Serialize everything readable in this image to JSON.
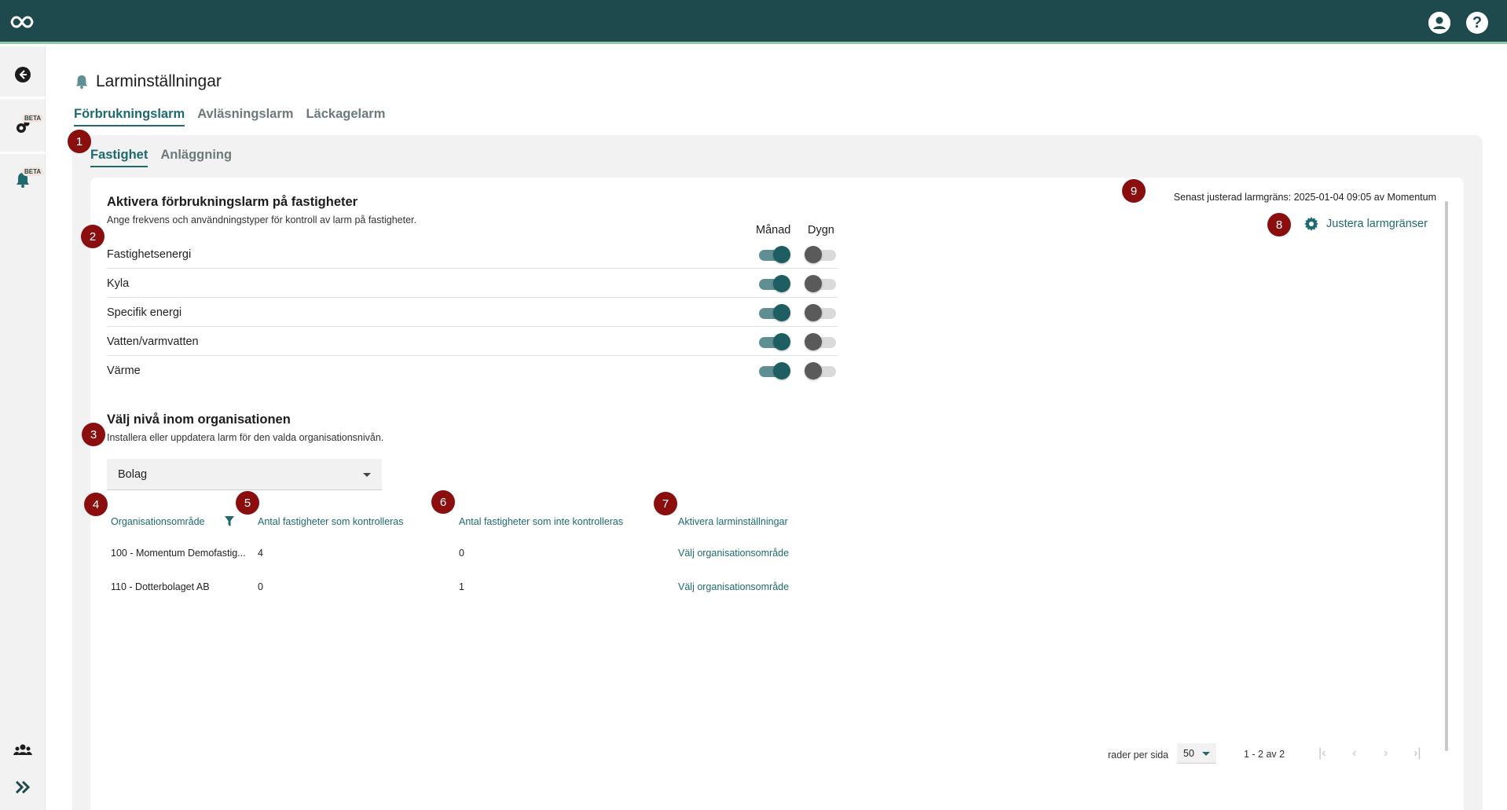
{
  "topbar": {
    "logo_icon": "infinity-logo-icon",
    "account_icon": "account-icon",
    "help_icon": "help-icon"
  },
  "rail": {
    "back_icon": "arrow-left-icon",
    "settings_beta": "BETA",
    "alarm_beta": "BETA",
    "users_icon": "users-icon",
    "expand_icon": "double-chevron-right-icon"
  },
  "header": {
    "title": "Larminställningar"
  },
  "main_tabs": [
    "Förbrukningslarm",
    "Avläsningslarm",
    "Läckagelarm"
  ],
  "sub_tabs": [
    "Fastighet",
    "Anläggning"
  ],
  "badges": [
    "1",
    "2",
    "3",
    "4",
    "5",
    "6",
    "7",
    "8",
    "9"
  ],
  "section1": {
    "title": "Aktivera förbrukningslarm på fastigheter",
    "subtitle": "Ange frekvens och användningstyper för kontroll av larm på fastigheter.",
    "col_month": "Månad",
    "col_day": "Dygn",
    "rows": [
      {
        "label": "Fastighetsenergi",
        "month": true,
        "day": false
      },
      {
        "label": "Kyla",
        "month": true,
        "day": false
      },
      {
        "label": "Specifik energi",
        "month": true,
        "day": false
      },
      {
        "label": "Vatten/varmvatten",
        "month": true,
        "day": false
      },
      {
        "label": "Värme",
        "month": true,
        "day": false
      }
    ]
  },
  "section2": {
    "title": "Välj nivå inom organisationen",
    "subtitle": "Installera eller uppdatera larm för den valda organisationsnivån.",
    "select_value": "Bolag"
  },
  "table": {
    "headers": [
      "Organisationsområde",
      "Antal fastigheter som kontrolleras",
      "Antal fastigheter som inte kontrolleras",
      "Aktivera larminställningar"
    ],
    "rows": [
      {
        "org": "100 - Momentum Demofastig...",
        "controlled": "4",
        "not_controlled": "0",
        "action": "Välj organisationsområde"
      },
      {
        "org": "110 - Dotterbolaget AB",
        "controlled": "0",
        "not_controlled": "1",
        "action": "Välj organisationsområde"
      }
    ]
  },
  "info": {
    "last_adjusted": "Senast justerad larmgräns: 2025-01-04 09:05 av Momentum",
    "adjust_label": "Justera larmgränser"
  },
  "pagination": {
    "rows_per_page_label": "rader per sida",
    "rows_per_page": "50",
    "range": "1 - 2 av 2"
  },
  "colors": {
    "brand": "#1e4a4d",
    "accent": "#1e6a6e",
    "badge": "#8b0e0e"
  }
}
